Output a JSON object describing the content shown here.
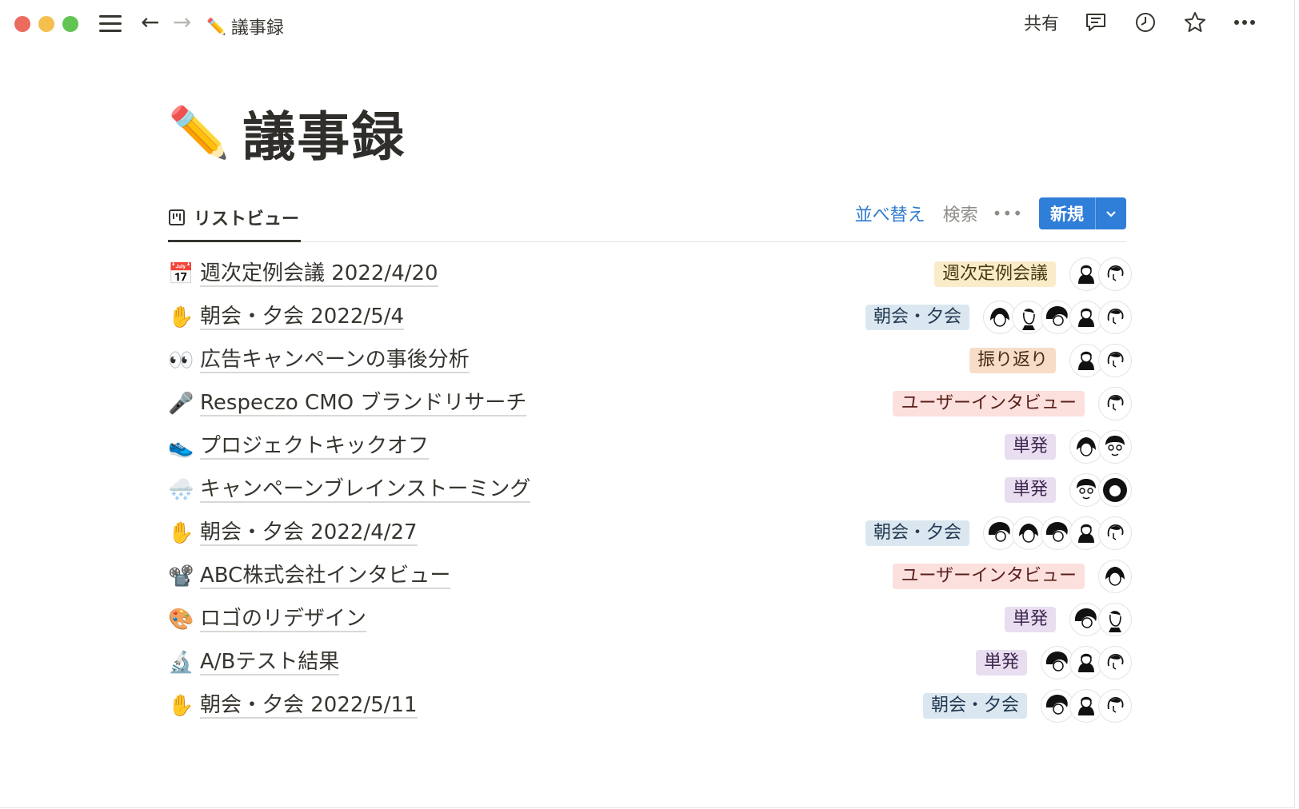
{
  "topbar": {
    "breadcrumb_emoji": "✏️",
    "breadcrumb_title": "議事録",
    "share_label": "共有"
  },
  "page": {
    "title_emoji": "✏️",
    "title": "議事録"
  },
  "view": {
    "tab_label": "リストビュー",
    "sort_label": "並べ替え",
    "search_label": "検索",
    "more_label": "•••",
    "new_label": "新規"
  },
  "colors": {
    "accent": "#2f7ed8",
    "sort_link": "#2f7ccf"
  },
  "rows": [
    {
      "emoji": "📅",
      "title": "週次定例会議 2022/4/20",
      "tag": "週次定例会議",
      "tag_color": "yellow",
      "avatars": [
        "person-a",
        "person-b"
      ]
    },
    {
      "emoji": "✋",
      "title": "朝会・夕会 2022/5/4",
      "tag": "朝会・夕会",
      "tag_color": "blue",
      "avatars": [
        "person-c",
        "person-d",
        "person-e",
        "person-a",
        "person-b"
      ]
    },
    {
      "emoji": "👀",
      "title": "広告キャンペーンの事後分析",
      "tag": "振り返り",
      "tag_color": "orange",
      "avatars": [
        "person-a",
        "person-b"
      ]
    },
    {
      "emoji": "🎤",
      "title": "Respeczo CMO ブランドリサーチ",
      "tag": "ユーザーインタビュー",
      "tag_color": "red",
      "avatars": [
        "person-b"
      ]
    },
    {
      "emoji": "👟",
      "title": "プロジェクトキックオフ",
      "tag": "単発",
      "tag_color": "purple",
      "avatars": [
        "person-c",
        "person-f"
      ]
    },
    {
      "emoji": "🌨️",
      "title": "キャンペーンブレインストーミング",
      "tag": "単発",
      "tag_color": "purple",
      "avatars": [
        "person-f",
        "person-g"
      ]
    },
    {
      "emoji": "✋",
      "title": "朝会・夕会 2022/4/27",
      "tag": "朝会・夕会",
      "tag_color": "blue",
      "avatars": [
        "person-e",
        "person-c",
        "person-e",
        "person-a",
        "person-b"
      ]
    },
    {
      "emoji": "📽️",
      "title": "ABC株式会社インタビュー",
      "tag": "ユーザーインタビュー",
      "tag_color": "red",
      "avatars": [
        "person-c"
      ]
    },
    {
      "emoji": "🎨",
      "title": "ロゴのリデザイン",
      "tag": "単発",
      "tag_color": "purple",
      "avatars": [
        "person-e",
        "person-d"
      ]
    },
    {
      "emoji": "🔬",
      "title": "A/Bテスト結果",
      "tag": "単発",
      "tag_color": "purple",
      "avatars": [
        "person-e",
        "person-a",
        "person-b"
      ]
    },
    {
      "emoji": "✋",
      "title": "朝会・夕会 2022/5/11",
      "tag": "朝会・夕会",
      "tag_color": "blue",
      "avatars": [
        "person-e",
        "person-a",
        "person-b"
      ]
    }
  ]
}
